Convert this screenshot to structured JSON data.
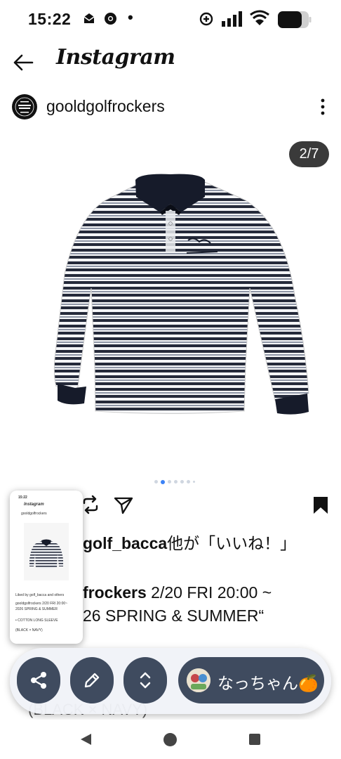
{
  "status": {
    "time": "15:22",
    "notif_dot": "•"
  },
  "app": {
    "title": "Instagram"
  },
  "post": {
    "username": "gooldgolfrockers",
    "counter": "2/7",
    "carousel_total": 7,
    "carousel_active_index": 1,
    "likes_user": "golf_bacca",
    "likes_suffix": "他が「いいね！」",
    "caption_user": "frockers",
    "caption_text": " 2/20 FRI 20:00 ~",
    "caption_line2": "26 SPRING & SUMMER“",
    "caption_line3": "(BLACK × NAVY)"
  },
  "thumbnail": {
    "time": "15:22",
    "title": "Instagram",
    "username": "gooldgolfrockers",
    "lines": [
      "Liked by golf_bacca and others",
      "gooldgolfrockers 2/20 FRI 20:00~",
      "2026 SPRING & SUMMER",
      "• COTTON LONG SLEEVE",
      "(BLACK × NAVY)"
    ]
  },
  "fab": {
    "share_icon": "share-icon",
    "edit_icon": "pencil-icon",
    "expand_icon": "expand-icon",
    "profile_name": "なっちゃん🍊"
  },
  "colors": {
    "fab_bg": "#3f4b5f",
    "counter_bg": "#3a3a3a",
    "dot_active": "#3b82f6",
    "dot_inactive": "#cfd6e0"
  }
}
